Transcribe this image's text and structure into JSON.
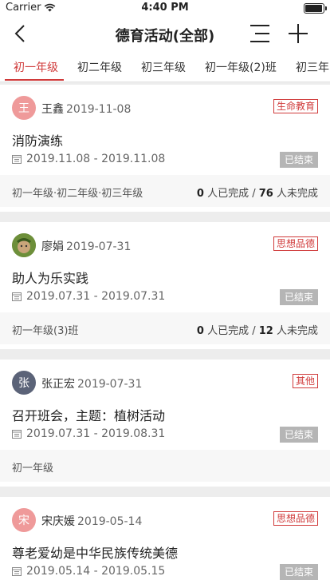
{
  "status_bar": {
    "carrier": "Carrier",
    "time": "4:40 PM"
  },
  "nav": {
    "title": "德育活动(全部)"
  },
  "tabs": [
    "初一年级",
    "初二年级",
    "初三年级",
    "初一年级(2)班",
    "初三年"
  ],
  "activities": [
    {
      "avatar_char": "王",
      "avatar_color": "#ef9a9a",
      "author": "王鑫",
      "date": "2019-11-08",
      "tag": "生命教育",
      "title": "消防演练",
      "period": "2019.11.08 - 2019.11.08",
      "status": "已结束",
      "classes": "初一年级·初二年级·初三年级",
      "completed": "0",
      "completed_label": "人已完成 /",
      "incomplete": "76",
      "incomplete_label": "人未完成"
    },
    {
      "avatar_char": "",
      "avatar_color": "#6d8f3a",
      "author": "廖娟",
      "date": "2019-07-31",
      "tag": "思想品德",
      "title": "助人为乐实践",
      "period": "2019.07.31 - 2019.07.31",
      "status": "已结束",
      "classes": "初一年级(3)班",
      "completed": "0",
      "completed_label": "人已完成 /",
      "incomplete": "12",
      "incomplete_label": "人未完成"
    },
    {
      "avatar_char": "张",
      "avatar_color": "#5b6378",
      "author": "张正宏",
      "date": "2019-07-31",
      "tag": "其他",
      "title": "召开班会，主题：植树活动",
      "period": "2019.07.31 - 2019.08.31",
      "status": "已结束",
      "classes": "初一年级"
    },
    {
      "avatar_char": "宋",
      "avatar_color": "#ef9a9a",
      "author": "宋庆媛",
      "date": "2019-05-14",
      "tag": "思想品德",
      "title": "尊老爱幼是中华民族传统美德",
      "period": "2019.05.14 - 2019.05.15",
      "status": "已结束"
    }
  ],
  "colors": {
    "accent": "#d03a3a",
    "status_gray": "#b5b5b5"
  }
}
